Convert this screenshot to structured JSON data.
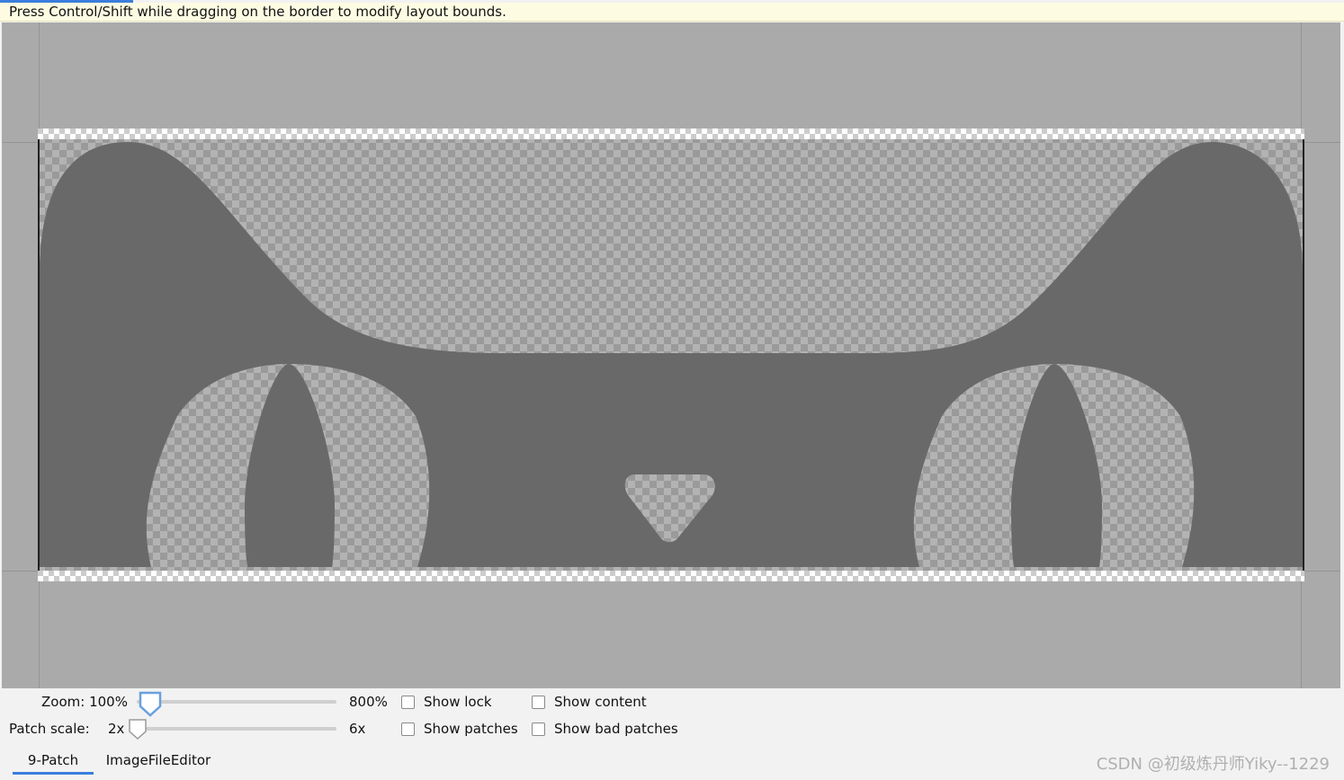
{
  "hint_bar": {
    "text": "Press Control/Shift while dragging on the border to modify layout bounds."
  },
  "editor_canvas": {
    "background_color": "#aaaaaa",
    "image_fill_color": "#696969",
    "checker_light": "#b3b3b3",
    "checker_dark": "#9a9a9a"
  },
  "controls": {
    "zoom": {
      "label": "Zoom: 100%",
      "max_label": "800%",
      "value_percent": 100
    },
    "patch_scale": {
      "label": "Patch scale:",
      "min_label": "2x",
      "max_label": "6x",
      "value": 2
    },
    "checkboxes": {
      "show_lock": {
        "label": "Show lock",
        "checked": false
      },
      "show_patches": {
        "label": "Show patches",
        "checked": false
      },
      "show_content": {
        "label": "Show content",
        "checked": false
      },
      "show_bad_patches": {
        "label": "Show bad patches",
        "checked": false
      }
    }
  },
  "tabs": [
    {
      "label": "9-Patch",
      "active": true
    },
    {
      "label": "ImageFileEditor",
      "active": false
    }
  ],
  "watermark": "CSDN @初级炼丹师Yiky--1229",
  "accent_color": "#3b7ddd"
}
